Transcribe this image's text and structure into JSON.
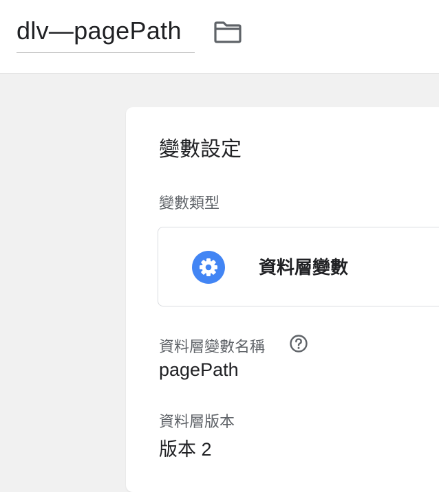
{
  "header": {
    "title": "dlv—pagePath",
    "folder_icon": "folder-icon"
  },
  "card": {
    "title": "變數設定",
    "variable_type": {
      "label": "變數類型",
      "name": "資料層變數",
      "icon": "gear-icon",
      "icon_color": "#4285f4"
    },
    "dlv_name": {
      "label": "資料層變數名稱",
      "help_icon": "help-icon",
      "value": "pagePath"
    },
    "dlv_version": {
      "label": "資料層版本",
      "value": "版本 2"
    }
  }
}
